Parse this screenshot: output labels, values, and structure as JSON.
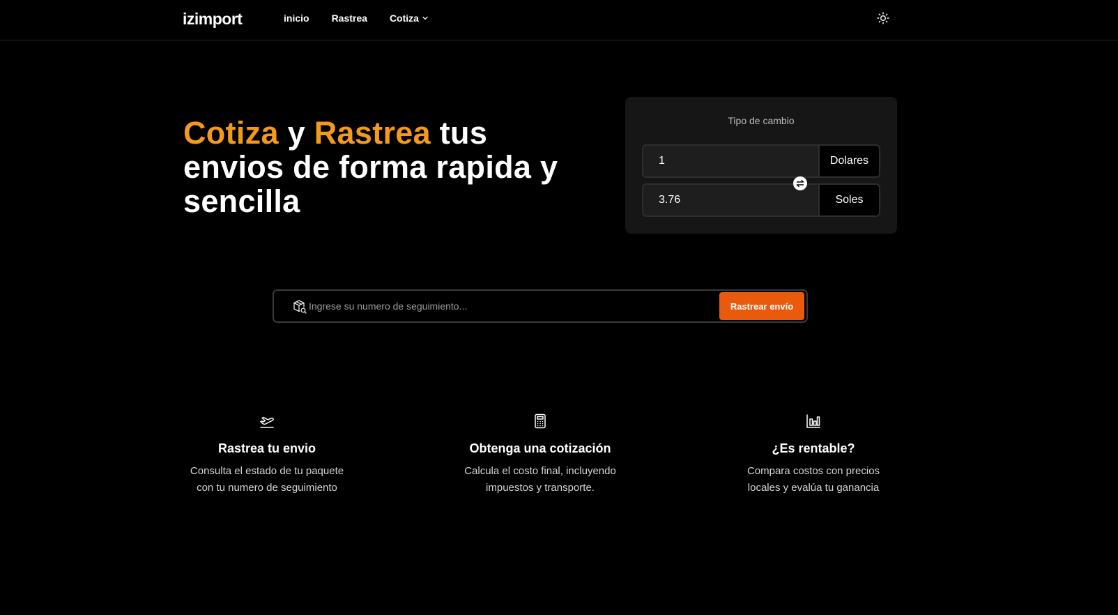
{
  "header": {
    "logo": "izimport",
    "nav": [
      {
        "label": "inicio"
      },
      {
        "label": "Rastrea"
      },
      {
        "label": "Cotiza"
      }
    ],
    "theme_icon": "sun-icon"
  },
  "hero": {
    "word1": "Cotiza",
    "word2": " y ",
    "word3": "Rastrea",
    "rest": " tus envios de forma rapida y sencilla",
    "accent_color": "#f39a1c"
  },
  "exchange": {
    "title": "Tipo de cambio",
    "from_value": "1",
    "from_currency": "Dolares",
    "to_value": "3.76",
    "to_currency": "Soles",
    "swap_icon": "swap-arrows-icon"
  },
  "tracking": {
    "placeholder": "Ingrese su numero de seguimiento...",
    "button_label": "Rastrear envío",
    "button_color": "#ea5a0c",
    "icon": "package-search-icon"
  },
  "features": [
    {
      "icon": "plane-takeoff-icon",
      "title": "Rastrea tu envio",
      "description": "Consulta el estado de tu paquete con tu numero de seguimiento"
    },
    {
      "icon": "calculator-icon",
      "title": "Obtenga una cotización",
      "description": "Calcula el costo final, incluyendo impuestos y transporte."
    },
    {
      "icon": "bar-chart-icon",
      "title": "¿Es rentable?",
      "description": "Compara costos con precios locales y evalúa tu ganancia"
    }
  ]
}
